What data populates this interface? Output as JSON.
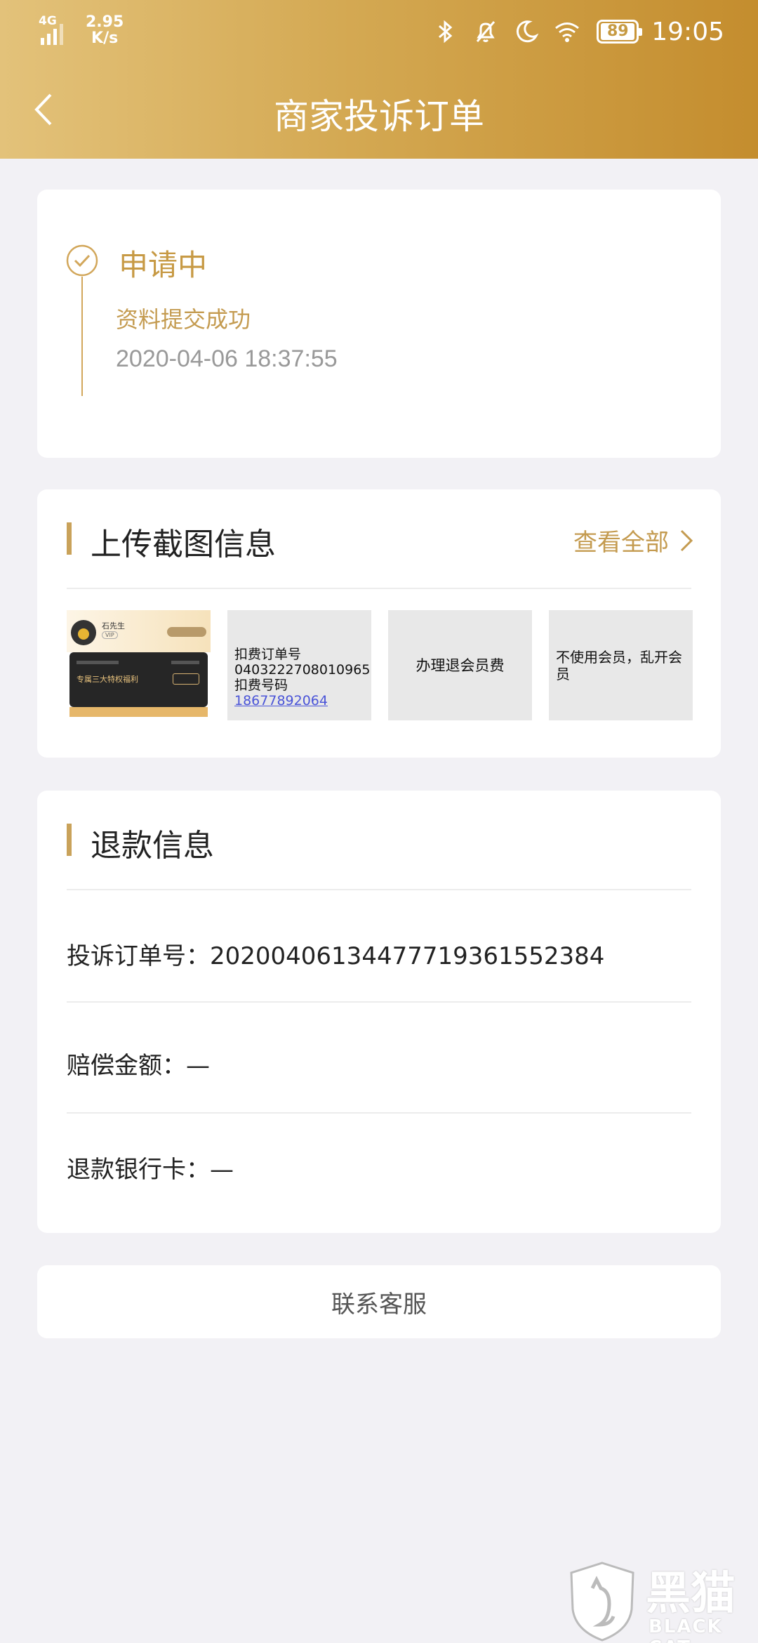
{
  "status_bar": {
    "network": "4G",
    "speed_value": "2.95",
    "speed_unit": "K/s",
    "battery": "89",
    "time": "19:05",
    "icons": [
      "signal-icon",
      "bluetooth-icon",
      "bell-off-icon",
      "moon-icon",
      "wifi-icon",
      "battery-icon"
    ]
  },
  "header": {
    "title": "商家投诉订单",
    "back_icon": "chevron-left-icon"
  },
  "status_card": {
    "title": "申请中",
    "subtitle": "资料提交成功",
    "timestamp": "2020-04-06 18:37:55",
    "icon": "check-circle-icon"
  },
  "screenshots_card": {
    "title": "上传截图信息",
    "view_all": "查看全部",
    "thumbnails": [
      {
        "kind": "membership-screenshot",
        "name_text": "石先生",
        "vip_text": "VIP",
        "card_title": "专属三大特权福利"
      },
      {
        "lines": [
          "扣费订单号",
          "0403222708010965",
          "扣费号码"
        ],
        "phone": "18677892064"
      },
      {
        "text": "办理退会员费"
      },
      {
        "text": "不使用会员，乱开会员"
      }
    ]
  },
  "refund_card": {
    "title": "退款信息",
    "rows": [
      {
        "label": "投诉订单号：",
        "value": "20200406134477719361552384"
      },
      {
        "label": "赔偿金额：",
        "value": "—"
      },
      {
        "label": "退款银行卡：",
        "value": "—"
      }
    ]
  },
  "contact_button": {
    "label": "联系客服"
  },
  "watermark": {
    "cn": "黑猫",
    "en": "BLACK CAT"
  },
  "colors": {
    "header_gradient": [
      "#e3c27a",
      "#c48d2e"
    ],
    "accent": "#c79a45",
    "background": "#f2f1f5"
  }
}
